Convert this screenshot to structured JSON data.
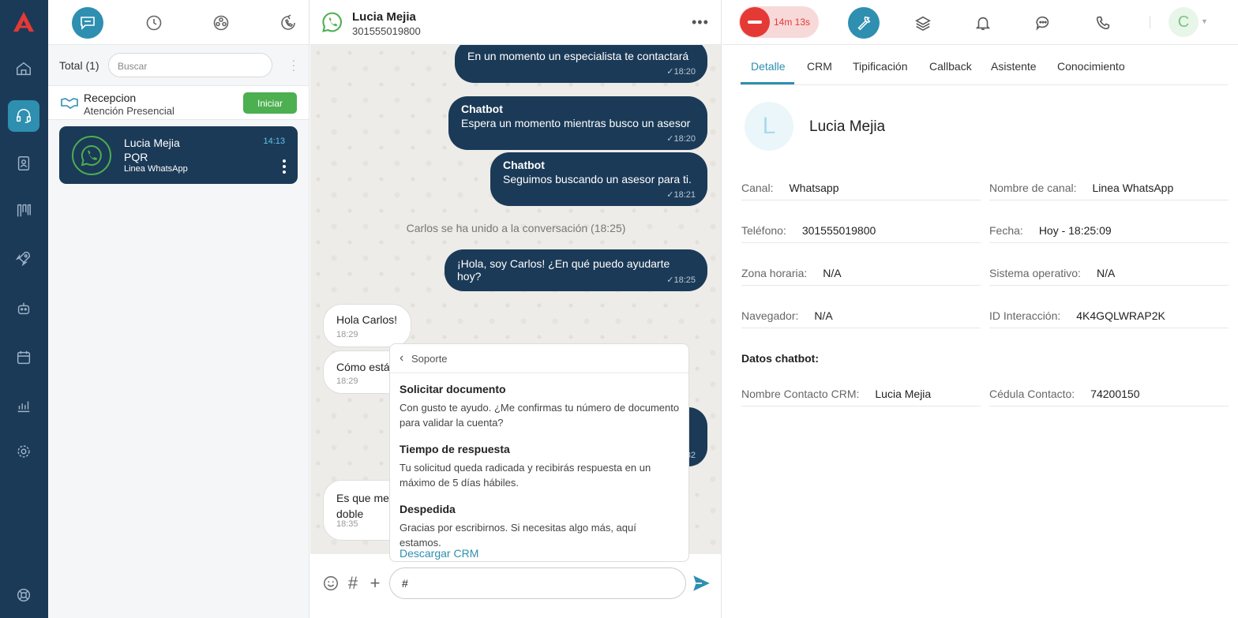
{
  "queue": {
    "total_label": "Total (1)",
    "search_placeholder": "Buscar",
    "reception": {
      "title": "Recepcion",
      "subtitle": "Atención Presencial",
      "button": "Iniciar"
    },
    "card": {
      "name": "Lucia Mejia",
      "type": "PQR",
      "line": "Linea WhatsApp",
      "time": "14:13"
    }
  },
  "chat": {
    "contact_name": "Lucia Mejia",
    "contact_phone": "301555019800",
    "messages": [
      {
        "text": "En un momento un especialista te contactará",
        "time": "✓18:20"
      },
      {
        "sender": "Chatbot",
        "text": "Espera un momento mientras busco un asesor",
        "time": "✓18:20"
      },
      {
        "sender": "Chatbot",
        "text": "Seguimos buscando un asesor para ti.",
        "time": "✓18:21"
      },
      {
        "text": "¡Hola, soy Carlos! ¿En qué puedo ayudarte hoy?",
        "time": "✓18:25"
      },
      {
        "text": "Hola Carlos!",
        "time": "18:29"
      },
      {
        "text": "Cómo está",
        "time": "18:29"
      },
      {
        "text": "Es que me",
        "text2": "doble",
        "time": "18:35"
      },
      {
        "time": "32"
      }
    ],
    "system_message": "Carlos se ha unido a la conversación (18:25)",
    "popup": {
      "header": "Soporte",
      "items": [
        {
          "title": "Solicitar documento",
          "desc": "Con gusto te ayudo. ¿Me confirmas tu número de documento para validar la cuenta?"
        },
        {
          "title": "Tiempo de respuesta",
          "desc": "Tu solicitud queda radicada y recibirás respuesta en un máximo de 5 días hábiles."
        },
        {
          "title": "Despedida",
          "desc": "Gracias por escribirnos. Si necesitas algo más, aquí estamos."
        }
      ],
      "link": "Descargar CRM"
    },
    "composer_value": "#"
  },
  "right": {
    "timer": "14m 13s",
    "avatar_letter": "C",
    "tabs": [
      "Detalle",
      "CRM",
      "Tipificación",
      "Callback",
      "Asistente",
      "Conocimiento"
    ],
    "contact_initial": "L",
    "contact_name": "Lucia Mejia",
    "fields": [
      {
        "label": "Canal:",
        "value": "Whatsapp"
      },
      {
        "label": "Nombre de canal:",
        "value": "Linea WhatsApp"
      },
      {
        "label": "Teléfono:",
        "value": "301555019800"
      },
      {
        "label": "Fecha:",
        "value": "Hoy - 18:25:09"
      },
      {
        "label": "Zona horaria:",
        "value": "N/A"
      },
      {
        "label": "Sistema operativo:",
        "value": "N/A"
      },
      {
        "label": "Navegador:",
        "value": "N/A"
      },
      {
        "label": "ID Interacción:",
        "value": "4K4GQLWRAP2K"
      },
      {
        "label": "Nombre Contacto CRM:",
        "value": "Lucia Mejia"
      },
      {
        "label": "Cédula Contacto:",
        "value": "74200150"
      }
    ],
    "chatbot_header": "Datos chatbot:"
  },
  "colors": {
    "rail": "#1b3a57",
    "accent": "#2e8fb0",
    "green": "#4caf50",
    "danger": "#e53935"
  }
}
